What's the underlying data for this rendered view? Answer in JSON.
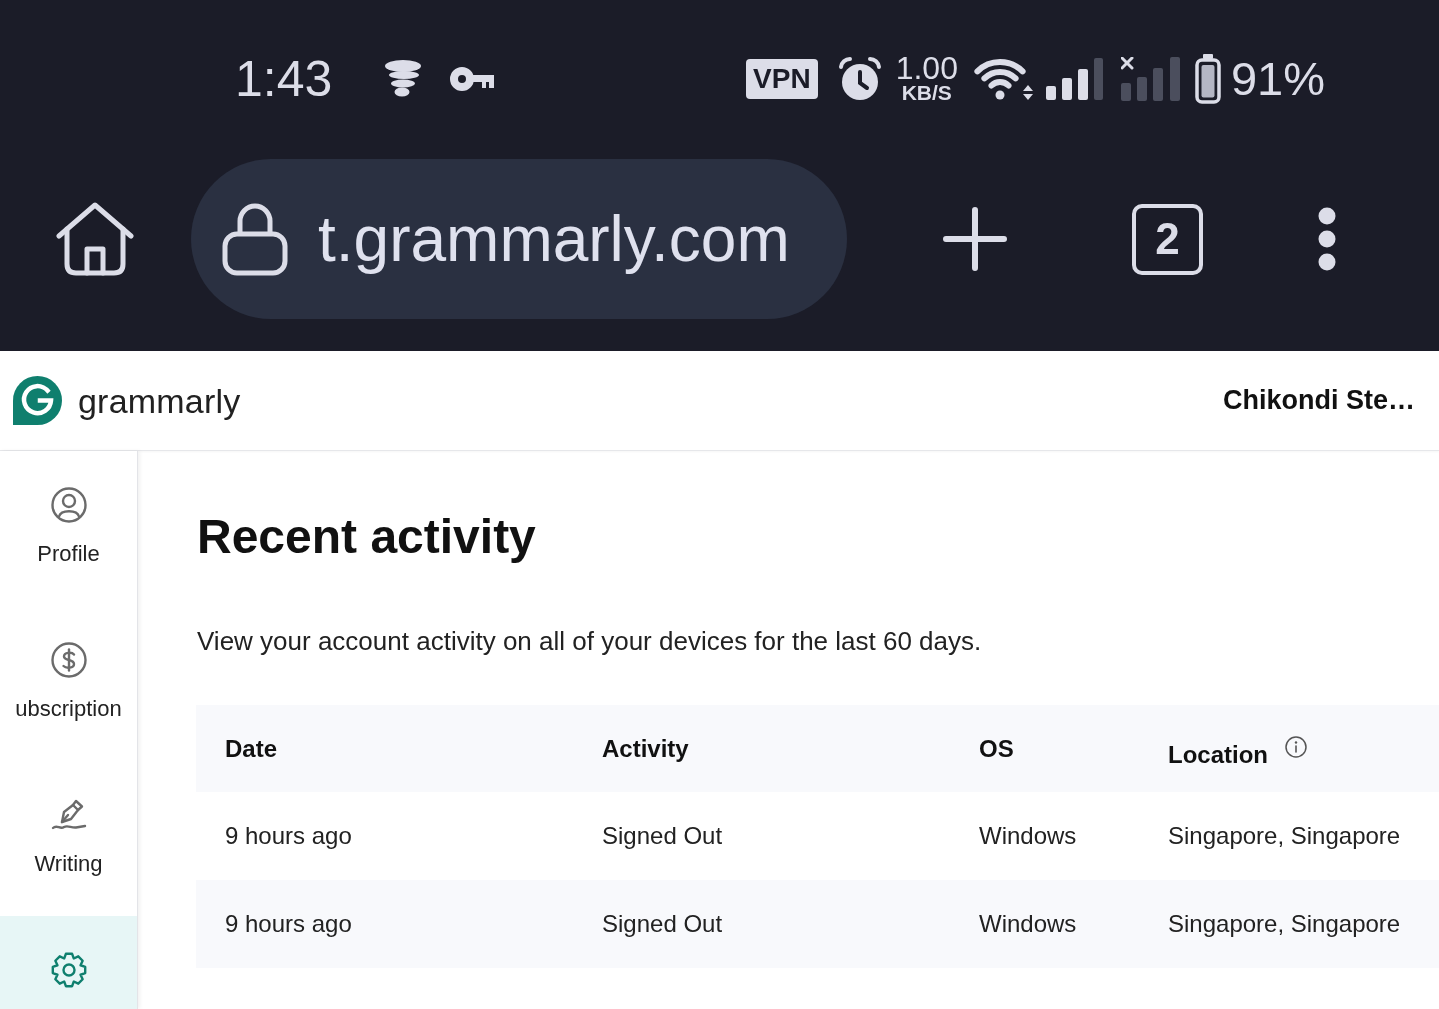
{
  "status_bar": {
    "time": "1:43",
    "vpn_badge": "VPN",
    "network_speed": "1.00",
    "network_speed_unit": "KB/S",
    "battery": "91%"
  },
  "browser_toolbar": {
    "url": "t.grammarly.com",
    "tab_count": "2"
  },
  "app_header": {
    "brand": "grammarly",
    "user_name": "Chikondi Ste…"
  },
  "sidebar": {
    "items": [
      {
        "label": "Profile",
        "selected": false
      },
      {
        "label": "ubscription",
        "selected": false
      },
      {
        "label": "Writing",
        "selected": false
      },
      {
        "selected": true
      }
    ]
  },
  "main": {
    "title": "Recent activity",
    "description": "View your account activity on all of your devices for the last 60 days.",
    "table": {
      "columns": [
        "Date",
        "Activity",
        "OS",
        "Location"
      ],
      "rows": [
        [
          "9 hours ago",
          "Signed Out",
          "Windows",
          "Singapore, Singapore"
        ],
        [
          "9 hours ago",
          "Signed Out",
          "Windows",
          "Singapore, Singapore"
        ]
      ]
    }
  }
}
